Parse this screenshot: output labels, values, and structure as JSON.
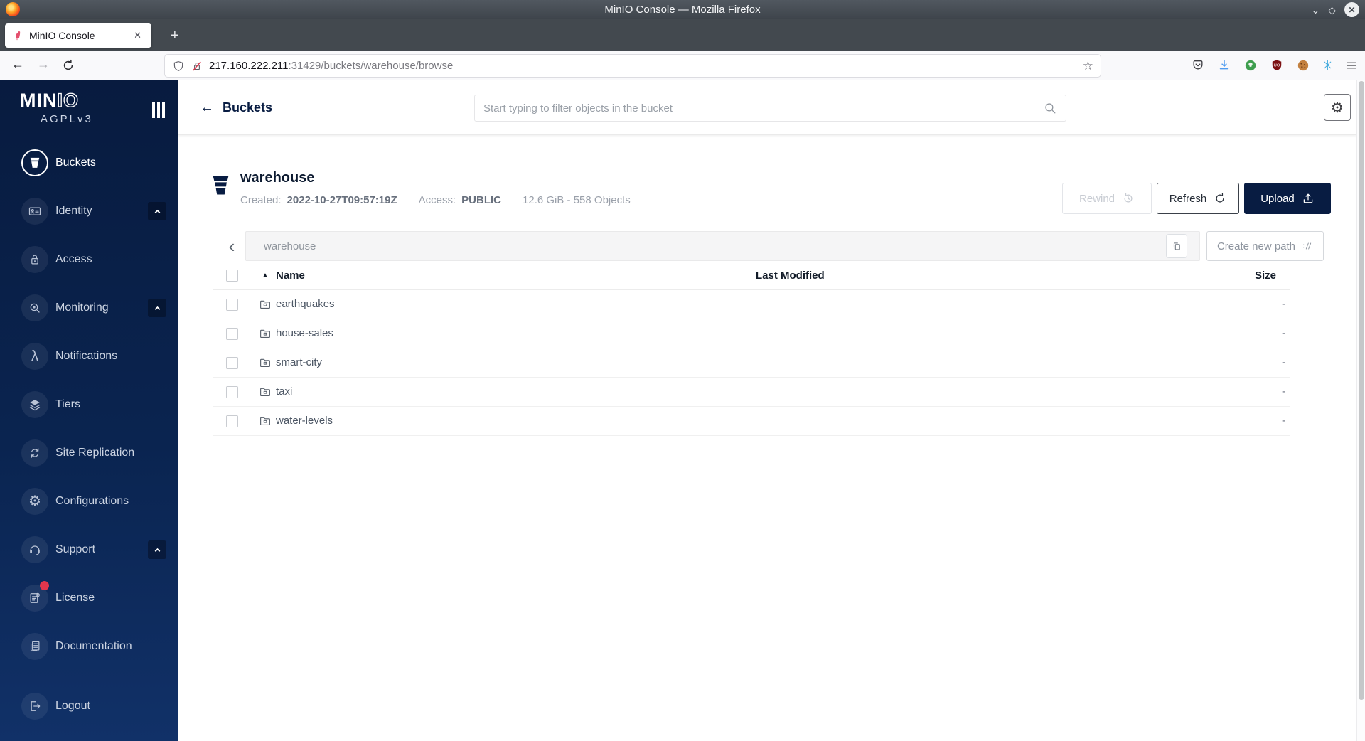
{
  "titlebar": {
    "title": "MinIO Console — Mozilla Firefox"
  },
  "tabbar": {
    "tab_title": "MinIO Console",
    "new_tab_glyph": "+",
    "close_glyph": "✕"
  },
  "navbar": {
    "back_glyph": "←",
    "forward_glyph": "→",
    "url_host": "217.160.222.211",
    "url_rest": ":31429/buckets/warehouse/browse",
    "star_glyph": "☆"
  },
  "window_controls": {
    "minimize_glyph": "⌄",
    "maximize_glyph": "◇",
    "close_glyph": "✕"
  },
  "sidebar": {
    "logo_solid": "MIN",
    "logo_hollow": "IO",
    "license_edition": "AGPLv3",
    "items": [
      {
        "label": "Buckets"
      },
      {
        "label": "Identity"
      },
      {
        "label": "Access"
      },
      {
        "label": "Monitoring"
      },
      {
        "label": "Notifications"
      },
      {
        "label": "Tiers"
      },
      {
        "label": "Site Replication"
      },
      {
        "label": "Configurations"
      },
      {
        "label": "Support"
      },
      {
        "label": "License"
      },
      {
        "label": "Documentation"
      },
      {
        "label": "Logout"
      }
    ]
  },
  "header": {
    "back_glyph": "←",
    "breadcrumb": "Buckets",
    "search_placeholder": "Start typing to filter objects in the bucket"
  },
  "bucket": {
    "name": "warehouse",
    "created_label": "Created:",
    "created_value": "2022-10-27T09:57:19Z",
    "access_label": "Access:",
    "access_value": "PUBLIC",
    "summary": "12.6 GiB - 558 Objects",
    "rewind_label": "Rewind",
    "refresh_label": "Refresh",
    "upload_label": "Upload"
  },
  "pathbar": {
    "back_glyph": "‹",
    "current_path": "warehouse",
    "create_path_label": "Create new path"
  },
  "table": {
    "sort_glyph": "▲",
    "columns": [
      "Name",
      "Last Modified",
      "Size"
    ],
    "rows": [
      {
        "name": "earthquakes",
        "modified": "",
        "size": "-"
      },
      {
        "name": "house-sales",
        "modified": "",
        "size": "-"
      },
      {
        "name": "smart-city",
        "modified": "",
        "size": "-"
      },
      {
        "name": "taxi",
        "modified": "",
        "size": "-"
      },
      {
        "name": "water-levels",
        "modified": "",
        "size": "-"
      }
    ]
  },
  "icons": {
    "lambda": "λ",
    "gear": "⚙",
    "asterisk": "✳"
  },
  "colors": {
    "accent_navy": "#081C42",
    "badge_red": "#E2364D",
    "sidebar_top": "#081B3F",
    "sidebar_bottom": "#113168"
  }
}
